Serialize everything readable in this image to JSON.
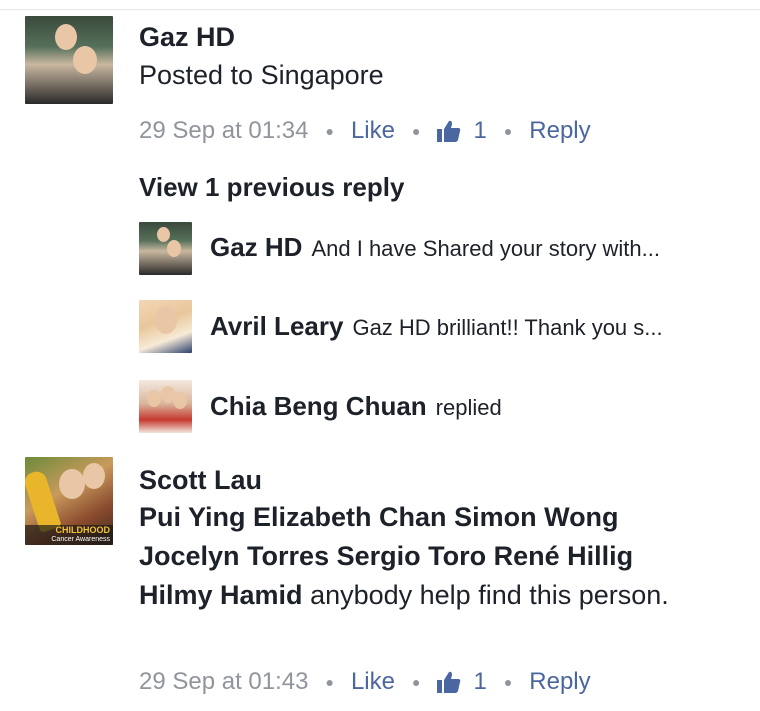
{
  "comments": [
    {
      "author": "Gaz HD",
      "text": "Posted to Singapore",
      "time": "29 Sep at 01:34",
      "like_label": "Like",
      "like_count": "1",
      "reply_label": "Reply"
    },
    {
      "author": "Scott Lau",
      "tagged": [
        "Pui Ying Elizabeth Chan",
        "Simon Wong",
        "Jocelyn Torres",
        "Sergio Toro",
        "René Hillig",
        "Hilmy Hamid"
      ],
      "text_after": "anybody help find this person.",
      "avatar_badge_line1": "CHILDHOOD",
      "avatar_badge_line2": "Cancer Awareness",
      "time": "29 Sep at 01:43",
      "like_label": "Like",
      "like_count": "1",
      "reply_label": "Reply"
    }
  ],
  "replies_section": {
    "view_previous": "View 1 previous reply",
    "replies": [
      {
        "author": "Gaz HD",
        "text": "And I have Shared your story with..."
      },
      {
        "author": "Avril Leary",
        "text": "Gaz HD brilliant!! Thank you s..."
      },
      {
        "author": "Chia Beng Chuan",
        "text": "replied"
      }
    ]
  },
  "icons": {
    "like": "thumbs-up-icon"
  },
  "colors": {
    "link": "#4b67a1",
    "meta": "#90949c",
    "text": "#1d2129"
  }
}
